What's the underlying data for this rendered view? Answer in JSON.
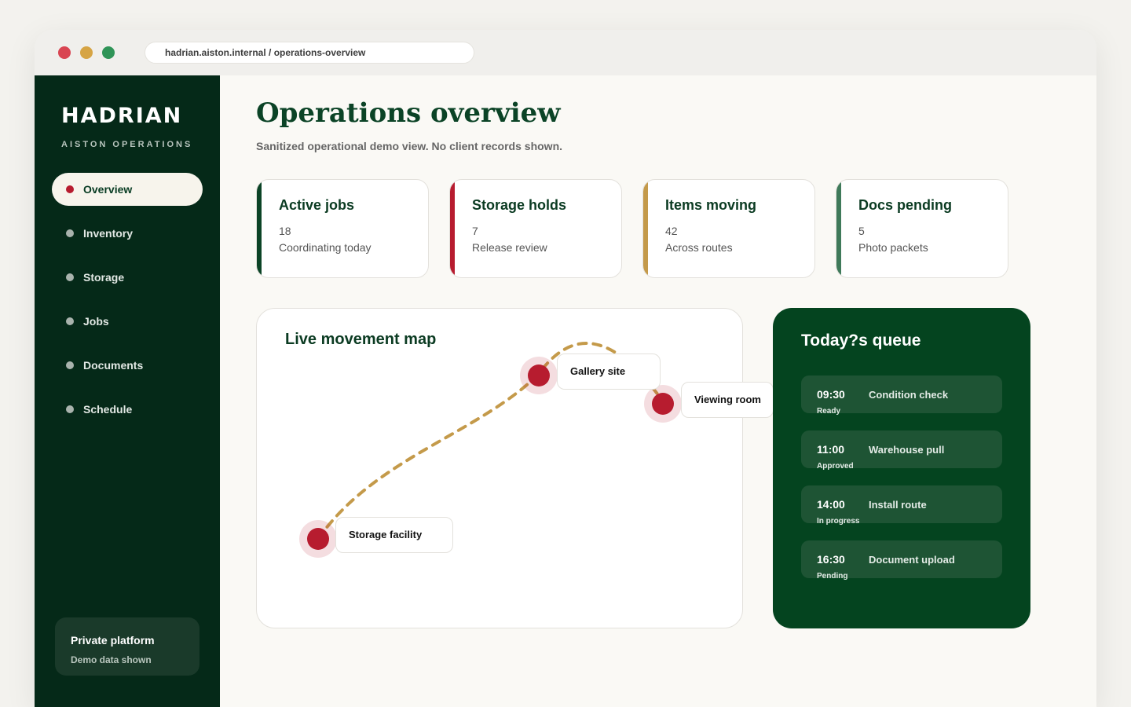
{
  "browser": {
    "url": "hadrian.aiston.internal / operations-overview"
  },
  "sidebar": {
    "brand": "HADRIAN",
    "brand_sub": "AISTON OPERATIONS",
    "items": [
      {
        "label": "Overview",
        "active": true
      },
      {
        "label": "Inventory"
      },
      {
        "label": "Storage"
      },
      {
        "label": "Jobs"
      },
      {
        "label": "Documents"
      },
      {
        "label": "Schedule"
      }
    ],
    "footer": {
      "title": "Private platform",
      "subtitle": "Demo data shown"
    }
  },
  "main": {
    "title": "Operations overview",
    "subtitle": "Sanitized operational demo view. No client records shown."
  },
  "stats": [
    {
      "title": "Active jobs",
      "value": "18",
      "detail": "Coordinating today",
      "color": "#0b4326"
    },
    {
      "title": "Storage holds",
      "value": "7",
      "detail": "Release review",
      "color": "#b71c2f"
    },
    {
      "title": "Items moving",
      "value": "42",
      "detail": "Across routes",
      "color": "#c49a4a"
    },
    {
      "title": "Docs pending",
      "value": "5",
      "detail": "Photo packets",
      "color": "#3f7a5a"
    }
  ],
  "map": {
    "title": "Live movement map",
    "locations": [
      {
        "label": "Storage facility"
      },
      {
        "label": "Gallery site"
      },
      {
        "label": "Viewing room"
      }
    ],
    "route_color": "#c49a4a",
    "pin_color": "#b71c2f"
  },
  "queue": {
    "title": "Today?s queue",
    "items": [
      {
        "time": "09:30",
        "task": "Condition check",
        "status": "Ready"
      },
      {
        "time": "11:00",
        "task": "Warehouse pull",
        "status": "Approved"
      },
      {
        "time": "14:00",
        "task": "Install route",
        "status": "In progress"
      },
      {
        "time": "16:30",
        "task": "Document upload",
        "status": "Pending"
      }
    ]
  }
}
